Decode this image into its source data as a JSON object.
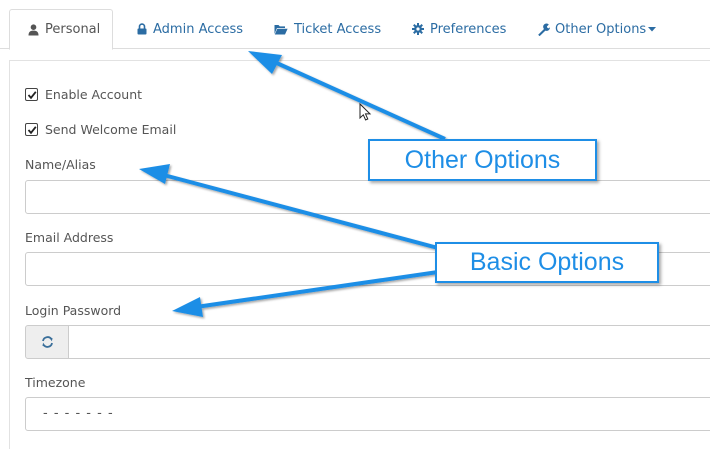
{
  "tabs": [
    {
      "label": "Personal",
      "icon": "user-icon",
      "active": true
    },
    {
      "label": "Admin Access",
      "icon": "lock-icon"
    },
    {
      "label": "Ticket Access",
      "icon": "folder-open-icon"
    },
    {
      "label": "Preferences",
      "icon": "gear-icon"
    },
    {
      "label": "Other Options",
      "icon": "wrench-icon",
      "dropdown": true
    }
  ],
  "form": {
    "enable_account": {
      "label": "Enable Account",
      "checked": true
    },
    "send_welcome": {
      "label": "Send Welcome Email",
      "checked": true
    },
    "name": {
      "label": "Name/Alias",
      "value": ""
    },
    "email": {
      "label": "Email Address",
      "value": ""
    },
    "password": {
      "label": "Login Password",
      "value": "",
      "addon_icon": "refresh-icon"
    },
    "timezone": {
      "label": "Timezone",
      "selected": "- - - - - - -"
    }
  },
  "annotations": {
    "other_options": "Other Options",
    "basic_options": "Basic Options"
  },
  "colors": {
    "link": "#2b6ca3",
    "annotation": "#1e8ee6",
    "border": "#cccccc"
  }
}
